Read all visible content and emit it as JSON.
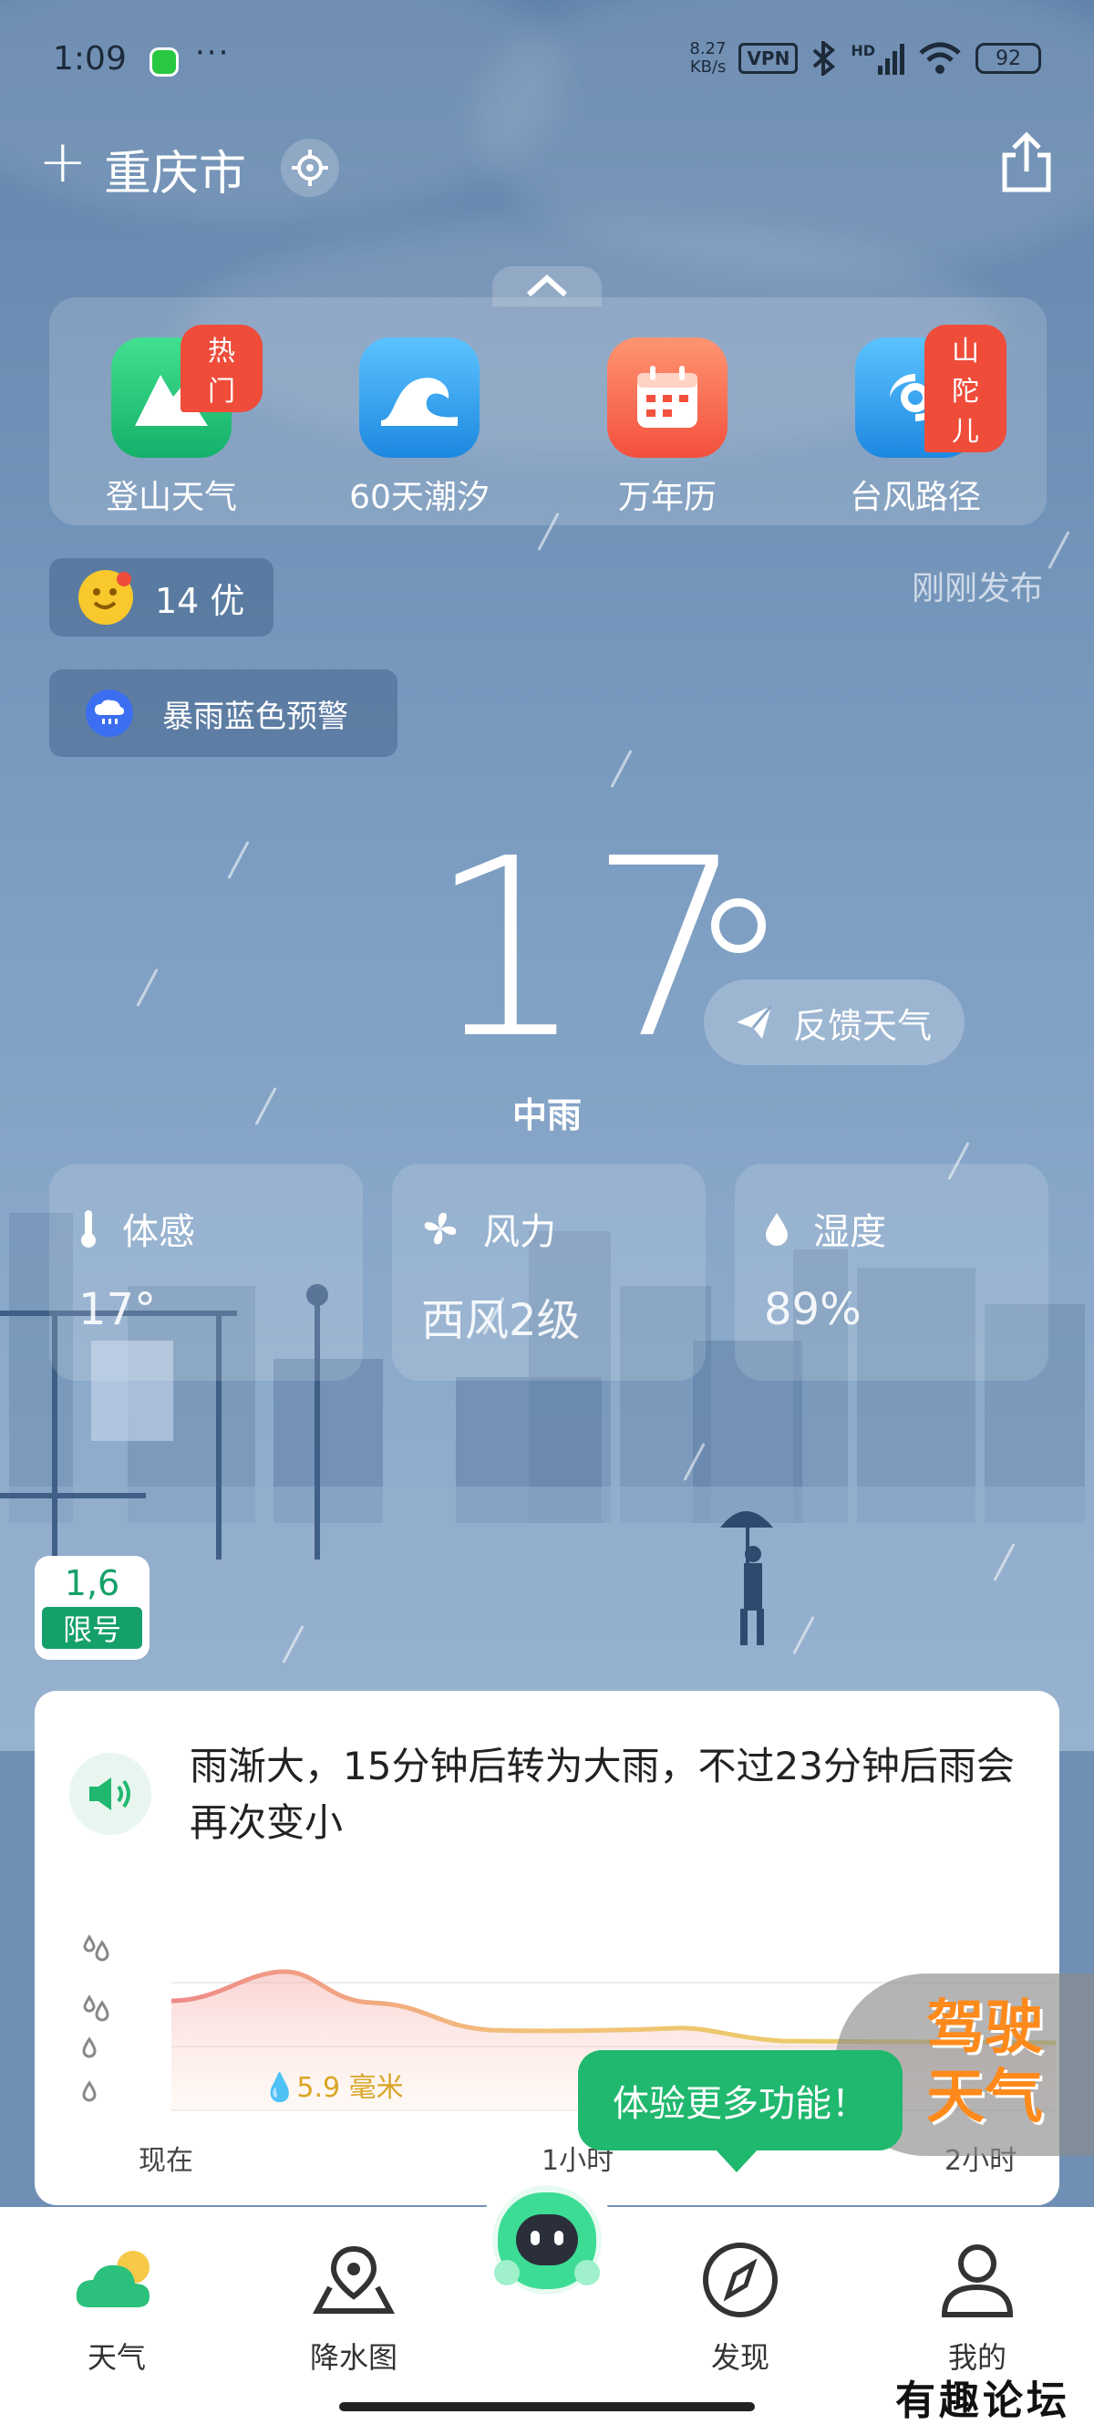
{
  "status_bar": {
    "time": "1:09",
    "speed_value": "8.27",
    "speed_unit": "KB/s",
    "vpn": "VPN",
    "network": "HD",
    "battery": "92"
  },
  "header": {
    "city": "重庆市"
  },
  "shortcuts": [
    {
      "label": "登山天气",
      "tag": "热门",
      "icon": "mountain-icon",
      "color": "#2ec97a"
    },
    {
      "label": "60天潮汐",
      "tag": "",
      "icon": "wave-icon",
      "color": "#2e9ef0"
    },
    {
      "label": "万年历",
      "tag": "",
      "icon": "calendar-icon",
      "color": "#f4624a"
    },
    {
      "label": "台风路径",
      "tag": "山陀儿",
      "icon": "typhoon-icon",
      "color": "#2e9ef0"
    }
  ],
  "aqi": {
    "value": "14 优"
  },
  "published": "刚刚发布",
  "warning": {
    "text": "暴雨蓝色预警"
  },
  "current": {
    "temperature": "17",
    "condition": "中雨",
    "feedback_label": "反馈天气"
  },
  "details": [
    {
      "title": "体感",
      "value": "17°",
      "icon": "thermometer-icon"
    },
    {
      "title": "风力",
      "value": "西风2级",
      "icon": "fan-icon"
    },
    {
      "title": "湿度",
      "value": "89%",
      "icon": "drop-icon"
    }
  ],
  "traffic_limit": {
    "numbers": "1,6",
    "label": "限号"
  },
  "precipitation": {
    "summary": "雨渐大，15分钟后转为大雨，不过23分钟后雨会再次变小",
    "amount": "5.9 毫米",
    "x_labels": [
      "现在",
      "1小时",
      "2小时"
    ]
  },
  "tooltip": "体验更多功能！",
  "promo": "驾驶天气",
  "nav": [
    {
      "label": "天气",
      "icon": "weather-icon"
    },
    {
      "label": "降水图",
      "icon": "map-pin-icon"
    },
    {
      "label": "发现",
      "icon": "compass-icon"
    },
    {
      "label": "我的",
      "icon": "user-icon"
    }
  ],
  "watermark": "有趣论坛",
  "colors": {
    "accent": "#20b86e",
    "tag_red": "#ef4c3a",
    "sky": "#6f90b4"
  }
}
